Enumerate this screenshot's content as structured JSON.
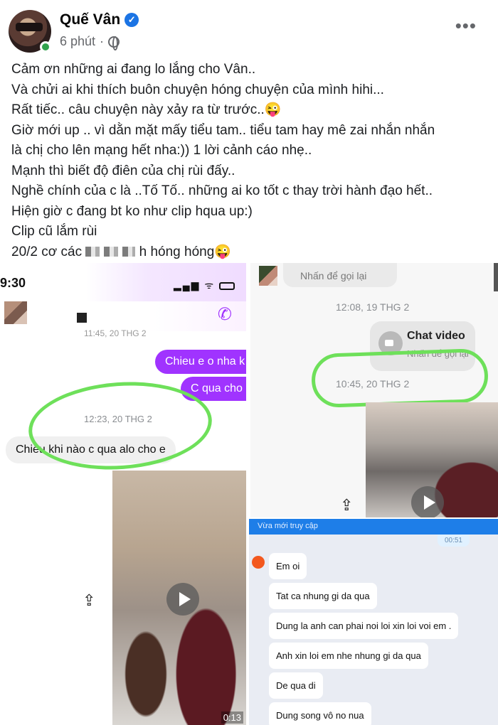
{
  "post": {
    "author": "Quế Vân",
    "time": "6 phút",
    "lines": [
      "Cảm ơn những ai đang lo lắng cho Vân..",
      "Và chửi ai khi thích buôn chuyện hóng chuyện của mình hihi...",
      "Rất tiếc.. câu chuyện này xảy ra từ trước..😜",
      "Giờ mới up .. vì dằn mặt mấy tiểu tam.. tiểu tam hay mê zai nhắn nhắn",
      "là chị cho lên mạng hết nha:)) 1 lời cảnh cáo nhẹ..",
      "Mạnh thì biết độ điên của chị rùi đấy..",
      "Nghề chính của c là ..Tố Tố.. những ai ko tốt c thay trời hành đạo hết..",
      "Hiện giờ c đang bt ko như clip hqua up:)",
      "Clip cũ lắm rùi"
    ],
    "last_line_start": "20/2 cơ các",
    "last_line_end": "h hóng hóng😜"
  },
  "left_shot": {
    "status_time": "9:30",
    "timestamp_top": "11:45, 20 THG 2",
    "sent_1": "Chieu e o nha k",
    "sent_2": "C qua cho",
    "timestamp_mid": "12:23, 20 THG 2",
    "received_1": "Chiều khi nào c qua alo cho e",
    "video_duration": "0:13"
  },
  "right_top": {
    "call_back": "Nhấn để gọi lại",
    "timestamp_1": "12:08, 19 THG 2",
    "video_card_title": "Chat video",
    "video_card_sub": "Nhấn để gọi lại",
    "timestamp_2": "10:45, 20 THG 2"
  },
  "right_bottom": {
    "header": "Vừa mới truy cập",
    "time": "00:51",
    "messages": [
      "Em oi",
      "Tat ca nhung gi da qua",
      "Dung la anh can phai noi loi xin loi voi em .",
      "Anh xin loi em nhe nhung gi da qua",
      "De qua di",
      "Dung song vô no nua"
    ]
  },
  "colors": {
    "messenger_purple": "#a033ff",
    "highlight_green": "#6ee05a",
    "facebook_blue": "#1b74e4",
    "zalo_blue": "#1e7ee8"
  }
}
